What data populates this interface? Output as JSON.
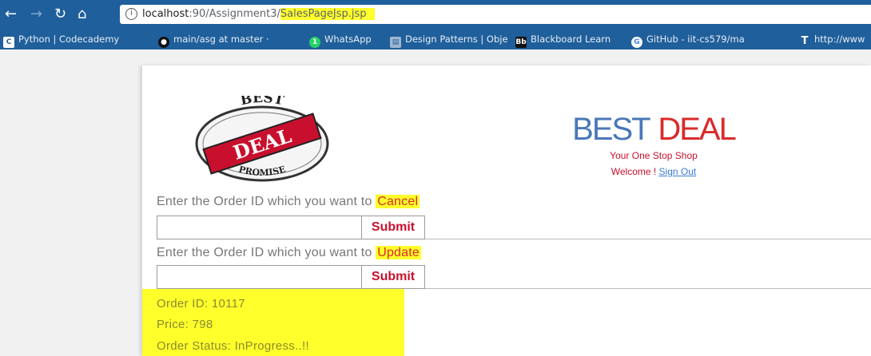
{
  "browser": {
    "url_host": "localhost",
    "url_path": ":90/Assignment3/",
    "url_highlight": "SalesPageJsp.jsp",
    "bookmarks": [
      {
        "label": "Python | Codecademy",
        "icon": "codecademy-icon"
      },
      {
        "label": "main/asg at master · ",
        "icon": "github-icon"
      },
      {
        "label": "WhatsApp",
        "icon": "whatsapp-icon"
      },
      {
        "label": "Design Patterns | Obje",
        "icon": "bookmark-page-icon"
      },
      {
        "label": "Blackboard Learn",
        "icon": "blackboard-icon"
      },
      {
        "label": "GitHub - iit-cs579/ma",
        "icon": "google-icon"
      },
      {
        "label": "http://www",
        "icon": "text-icon"
      }
    ]
  },
  "logo": {
    "top": "BEST",
    "middle": "DEAL",
    "bottom": "PROMISE"
  },
  "brand": {
    "title_best": "BEST",
    "title_deal": "DEAL",
    "tagline": "Your One Stop Shop",
    "welcome": "Welcome ! ",
    "signout": "Sign Out"
  },
  "cancel_form": {
    "prompt": "Enter the Order ID which you want to ",
    "action": "Cancel",
    "input_value": "",
    "submit_label": "Submit"
  },
  "update_form": {
    "prompt": "Enter the Order ID which you want to ",
    "action": "Update",
    "input_value": "",
    "submit_label": "Submit"
  },
  "result": {
    "order_id": "Order ID: 10117",
    "price": "Price: 798",
    "status": "Order Status: InProgress..!!"
  },
  "colors": {
    "chrome": "#1f5f9b",
    "highlight": "#ffff2b",
    "brand_blue": "#4a77b8",
    "brand_red": "#d92b2b"
  }
}
